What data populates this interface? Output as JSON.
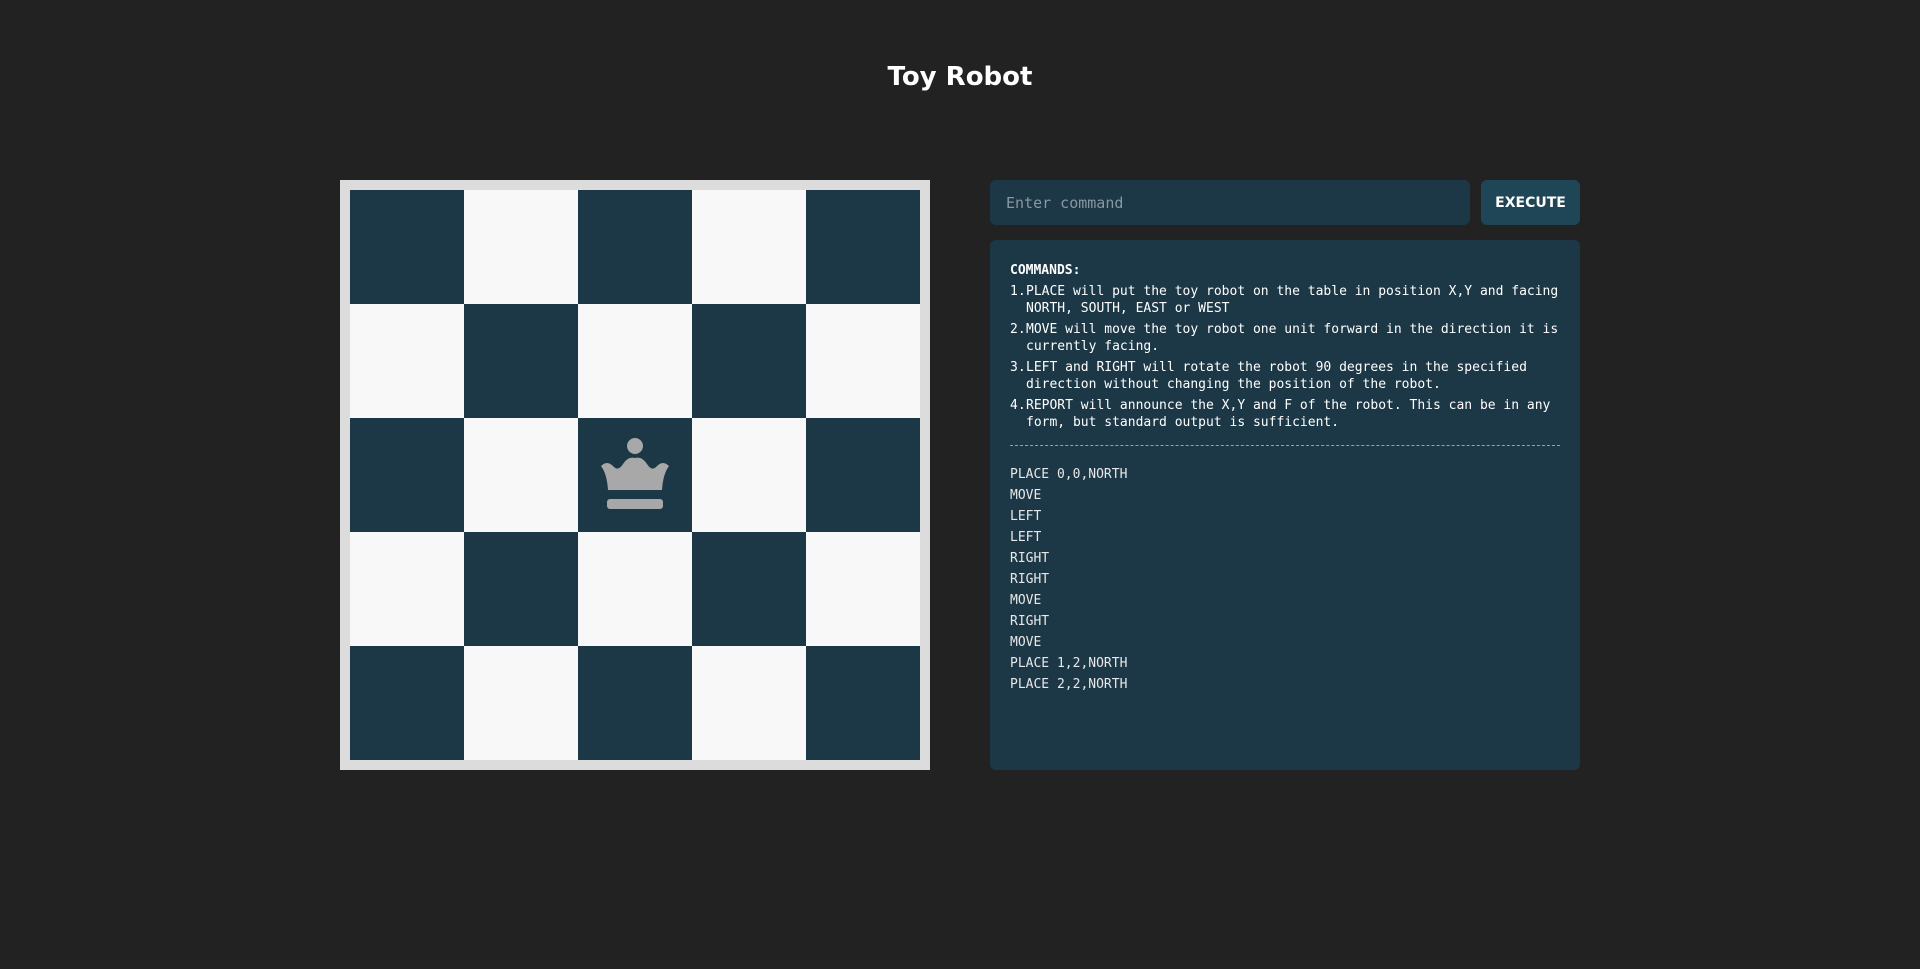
{
  "app": {
    "title": "Toy Robot"
  },
  "board": {
    "size": 5,
    "robot": {
      "x": 2,
      "y": 2,
      "facing": "NORTH",
      "icon": "queen-chess-icon",
      "color": "#a8a8a8"
    },
    "colors": {
      "dark": "#1c3746",
      "light": "#f8f8f8",
      "frame": "#dcdcdc"
    }
  },
  "command": {
    "placeholder": "Enter command",
    "value": "",
    "execute_label": "EXECUTE"
  },
  "help": {
    "heading": "COMMANDS:",
    "items": [
      {
        "num": "1.",
        "text": "PLACE will put the toy robot on the table in position X,Y and facing NORTH, SOUTH, EAST or WEST"
      },
      {
        "num": "2.",
        "text": "MOVE will move the toy robot one unit forward in the direction it is currently facing."
      },
      {
        "num": "3.",
        "text": "LEFT and RIGHT will rotate the robot 90 degrees in the specified direction without changing the position of the robot."
      },
      {
        "num": "4.",
        "text": "REPORT will announce the X,Y and F of the robot. This can be in any form, but standard output is sufficient."
      }
    ]
  },
  "history": [
    "PLACE 0,0,NORTH",
    "MOVE",
    "LEFT",
    "LEFT",
    "RIGHT",
    "RIGHT",
    "MOVE",
    "RIGHT",
    "MOVE",
    "PLACE 1,2,NORTH",
    "PLACE 2,2,NORTH"
  ],
  "theme": {
    "background": "#222222",
    "panel": "#1c3746",
    "button": "#1f4656"
  }
}
